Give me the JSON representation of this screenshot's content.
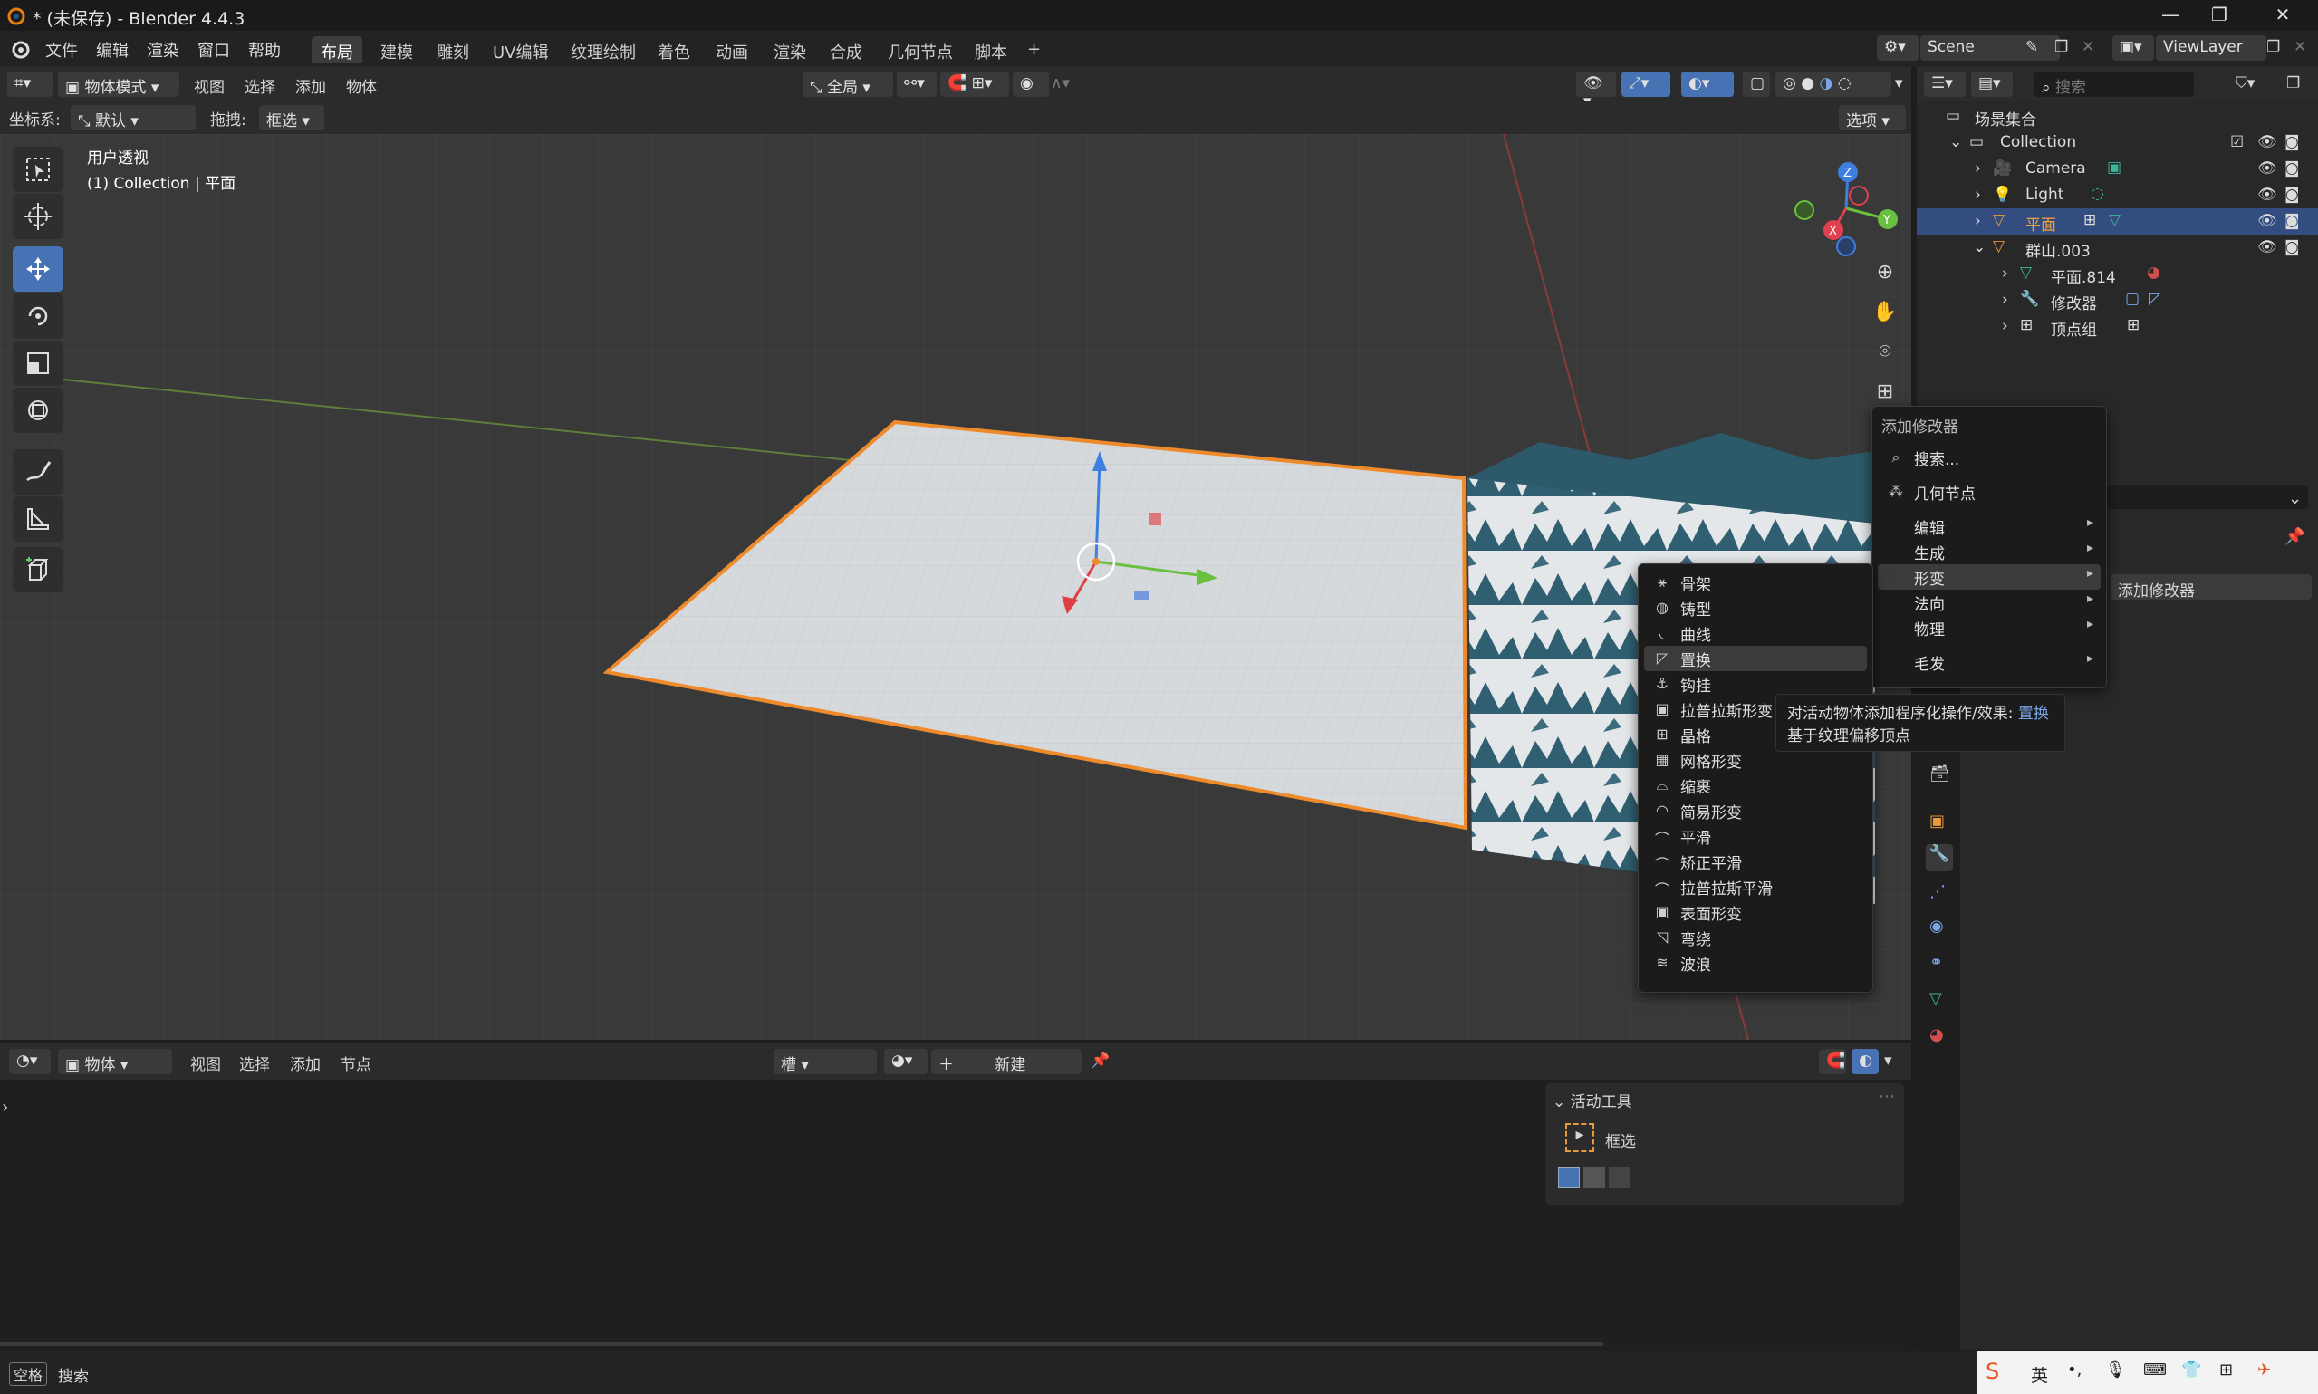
{
  "window": {
    "title": "* (未保存) - Blender 4.4.3"
  },
  "topbar": {
    "menus": [
      "文件",
      "编辑",
      "渲染",
      "窗口",
      "帮助"
    ],
    "workspaces": [
      "布局",
      "建模",
      "雕刻",
      "UV编辑",
      "纹理绘制",
      "着色",
      "动画",
      "渲染",
      "合成",
      "几何节点",
      "脚本"
    ],
    "active_workspace": 0,
    "scene": "Scene",
    "view_layer": "ViewLayer"
  },
  "viewport_header": {
    "mode": "物体模式",
    "menus": [
      "视图",
      "选择",
      "添加",
      "物体"
    ],
    "transform_orientation": "全局",
    "coord_label": "坐标系:",
    "coord_value": "默认",
    "drag_label": "拖拽:",
    "drag_value": "框选",
    "options": "选项"
  },
  "viewport": {
    "view_name": "用户透视",
    "collection_line": "(1) Collection | 平面",
    "gizmo_axes": {
      "x": "X",
      "y": "Y",
      "z": "Z"
    }
  },
  "outliner": {
    "search_placeholder": "搜索",
    "rows": [
      {
        "label": "场景集合",
        "indent": 0,
        "icon": "scene-collection-icon"
      },
      {
        "label": "Collection",
        "indent": 1,
        "icon": "collection-icon"
      },
      {
        "label": "Camera",
        "indent": 2,
        "icon": "camera-icon"
      },
      {
        "label": "Light",
        "indent": 2,
        "icon": "light-icon"
      },
      {
        "label": "平面",
        "indent": 2,
        "icon": "mesh-icon",
        "selected": true
      },
      {
        "label": "群山.003",
        "indent": 2,
        "icon": "mesh-icon"
      },
      {
        "label": "平面.814",
        "indent": 3,
        "icon": "mesh-data-icon"
      },
      {
        "label": "修改器",
        "indent": 3,
        "icon": "wrench-icon"
      },
      {
        "label": "顶点组",
        "indent": 3,
        "icon": "vertex-group-icon"
      }
    ]
  },
  "add_modifier_menu": {
    "title": "添加修改器",
    "search": "搜索...",
    "geometry_nodes": "几何节点",
    "categories": [
      "编辑",
      "生成",
      "形变",
      "法向",
      "物理",
      "毛发"
    ],
    "highlighted_category": "形变"
  },
  "deform_submenu": {
    "items": [
      "骨架",
      "铸型",
      "曲线",
      "置换",
      "钩挂",
      "拉普拉斯形变",
      "晶格",
      "网格形变",
      "缩裹",
      "简易形变",
      "平滑",
      "矫正平滑",
      "拉普拉斯平滑",
      "表面形变",
      "弯绕",
      "波浪"
    ],
    "highlighted": "置换"
  },
  "tooltip": {
    "line1_prefix": "对活动物体添加程序化操作/效果: ",
    "line1_highlight": "置换",
    "line2": "基于纹理偏移顶点"
  },
  "properties": {
    "add_modifier_button": "添加修改器"
  },
  "bottom_editor": {
    "mode": "物体",
    "menus": [
      "视图",
      "选择",
      "添加",
      "节点"
    ],
    "slot": "槽",
    "new_button": "新建",
    "active_tool_title": "活动工具",
    "active_tool_name": "框选"
  },
  "statusbar": {
    "key": "空格",
    "action": "搜索",
    "ime": [
      "英"
    ]
  }
}
